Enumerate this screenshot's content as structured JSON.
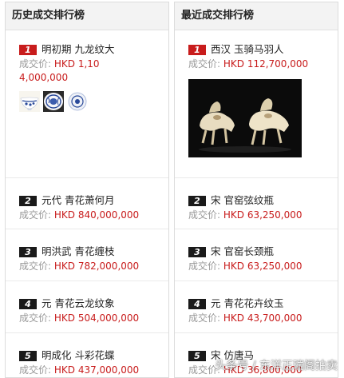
{
  "left": {
    "title": "历史成交排行榜",
    "items": [
      {
        "rank": "1",
        "name": "明初期 九龙纹大",
        "price_label": "成交价:",
        "price": "HKD 1,104,000,000"
      },
      {
        "rank": "2",
        "name": "元代 青花萧何月",
        "price_label": "成交价:",
        "price": "HKD 840,000,000"
      },
      {
        "rank": "3",
        "name": "明洪武 青花缠枝",
        "price_label": "成交价:",
        "price": "HKD 782,000,000"
      },
      {
        "rank": "4",
        "name": "元 青花云龙纹象",
        "price_label": "成交价:",
        "price": "HKD 504,000,000"
      },
      {
        "rank": "5",
        "name": "明成化 斗彩花蝶",
        "price_label": "成交价:",
        "price": "HKD 437,000,000"
      }
    ]
  },
  "right": {
    "title": "最近成交排行榜",
    "items": [
      {
        "rank": "1",
        "name": "西汉 玉骑马羽人",
        "price_label": "成交价:",
        "price": "HKD 112,700,000"
      },
      {
        "rank": "2",
        "name": "宋 官窑弦纹瓶",
        "price_label": "成交价:",
        "price": "HKD 63,250,000"
      },
      {
        "rank": "3",
        "name": "宋 官窑长颈瓶",
        "price_label": "成交价:",
        "price": "HKD 63,250,000"
      },
      {
        "rank": "4",
        "name": "元 青花花卉纹玉",
        "price_label": "成交价:",
        "price": "HKD 43,700,000"
      },
      {
        "rank": "5",
        "name": "宋 仿唐马",
        "price_label": "成交价:",
        "price": "HKD 36,800,000"
      }
    ]
  },
  "watermark": "头条号 / 东洋正瑞阁拍卖",
  "colors": {
    "accent_red": "#c81c1c",
    "badge_black": "#1a1a1a",
    "label_gray": "#999999"
  }
}
